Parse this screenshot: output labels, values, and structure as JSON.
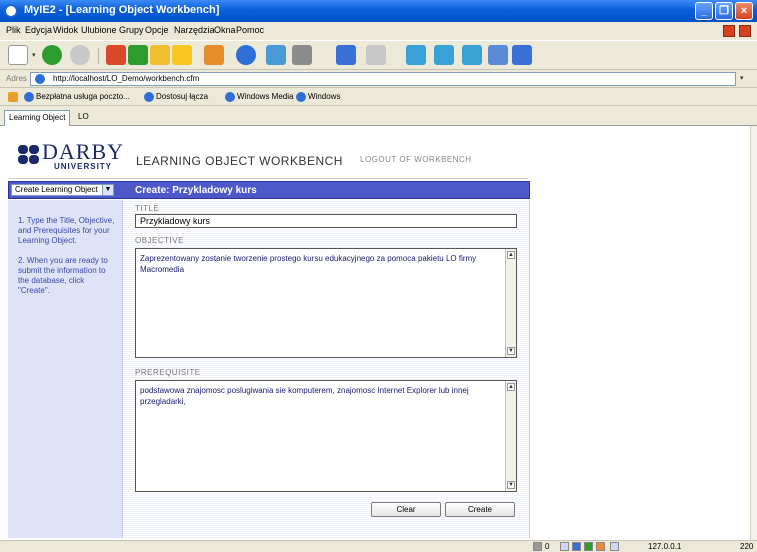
{
  "window": {
    "title": "MyIE2 - [Learning Object Workbench]"
  },
  "menu": [
    "Plik",
    "Edycja",
    "Widok",
    "Ulubione",
    "Grupy",
    "Opcje",
    "Narzędzia",
    "Okna",
    "Pomoc"
  ],
  "address": {
    "label": "Adres",
    "url": "http://localhost/LO_Demo/workbench.cfm"
  },
  "links": [
    "Bezpłatna usługa poczto...",
    "Dostosuj łącza",
    "Windows Media",
    "Windows"
  ],
  "tabs": [
    "Learning Object",
    "LO"
  ],
  "header": {
    "logo_name": "DARBY",
    "logo_sub": "UNIVERSITY",
    "app_title": "LEARNING OBJECT WORKBENCH",
    "logout": "LOGOUT OF WORKBENCH"
  },
  "toolbar": {
    "select_value": "Create Learning Object",
    "heading": "Create:  Przykladowy kurs"
  },
  "instructions": [
    "1. Type the Title, Objective, and Prerequisites for your Learning Object.",
    "2. When you are ready to submit the information to the database, click \"Create\"."
  ],
  "form": {
    "title_label": "TITLE",
    "title_value": "Przykladowy kurs",
    "objective_label": "OBJECTIVE",
    "objective_value": "Zaprezentowany zostanie tworzenie prostego kursu edukacyjnego za pomoca pakietu LO firmy Macromedia",
    "prerequisite_label": "PREREQUISITE",
    "prerequisite_value": "podstawowa znajomosc poslugiwania sie komputerem, znajomosc Internet Explorer lub innej przegladarki,",
    "clear_label": "Clear",
    "create_label": "Create"
  },
  "status": {
    "count": "0",
    "ip": "127.0.0.1",
    "tail": "220"
  }
}
